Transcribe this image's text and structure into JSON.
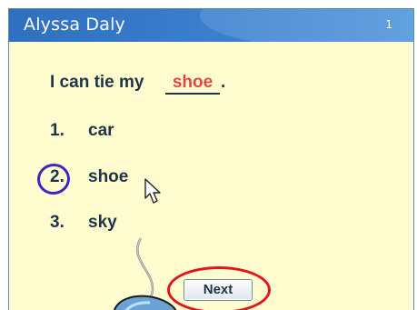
{
  "titlebar": {
    "name": "Alyssa Daly",
    "page_number": "1"
  },
  "question": {
    "prefix": "I can tie my",
    "answer": "shoe",
    "suffix": "."
  },
  "options": [
    {
      "number": "1.",
      "word": "car"
    },
    {
      "number": "2.",
      "word": "shoe"
    },
    {
      "number": "3.",
      "word": "sky"
    }
  ],
  "selected_option": "2.",
  "next_button": {
    "label": "Next"
  },
  "colors": {
    "titlebar": "#3b80cf",
    "background": "#fffdd0",
    "text": "#1f3347",
    "answer": "#e04848",
    "selection_circle": "#3b27c8",
    "highlight_ellipse": "#e3141b"
  }
}
